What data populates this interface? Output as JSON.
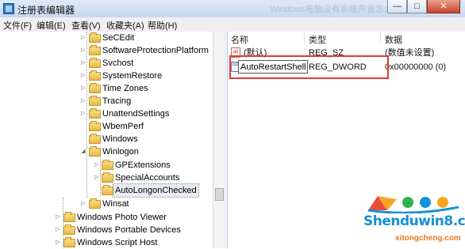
{
  "window": {
    "title": "注册表编辑器",
    "ghost_title": "Windows电脑没有系统声音怎么办",
    "min_glyph": "—",
    "max_glyph": "□",
    "close_glyph": "✕"
  },
  "menu": [
    "文件(F)",
    "编辑(E)",
    "查看(V)",
    "收藏夹(A)",
    "帮助(H)"
  ],
  "tree": [
    {
      "label": "SeCEdit",
      "arrow": "▷"
    },
    {
      "label": "SoftwareProtectionPlatform",
      "arrow": "▷"
    },
    {
      "label": "Svchost",
      "arrow": "▷"
    },
    {
      "label": "SystemRestore",
      "arrow": "▷"
    },
    {
      "label": "Time Zones",
      "arrow": "▷"
    },
    {
      "label": "Tracing",
      "arrow": "▷"
    },
    {
      "label": "UnattendSettings",
      "arrow": "▷"
    },
    {
      "label": "WbemPerf",
      "arrow": ""
    },
    {
      "label": "Windows",
      "arrow": ""
    },
    {
      "label": "Winlogon",
      "arrow": "◢"
    },
    {
      "label": "GPExtensions",
      "arrow": "▷"
    },
    {
      "label": "SpecialAccounts",
      "arrow": "▷"
    },
    {
      "label": "AutoLongonChecked",
      "arrow": ""
    },
    {
      "label": "Winsat",
      "arrow": "▷"
    },
    {
      "label": "Windows Photo Viewer",
      "arrow": "▷"
    },
    {
      "label": "Windows Portable Devices",
      "arrow": "▷"
    },
    {
      "label": "Windows Script Host",
      "arrow": "▷"
    }
  ],
  "list": {
    "headers": {
      "name": "名称",
      "type": "类型",
      "data": "数据"
    },
    "rows": [
      {
        "name": "(默认)",
        "type": "REG_SZ",
        "data": "(数值未设置)",
        "icon": "ab"
      },
      {
        "name": "AutoRestartShell",
        "type": "REG_DWORD",
        "data": "0x00000000 (0)",
        "icon": "011"
      }
    ]
  },
  "watermark": {
    "main": "Shenduwin8.com",
    "sub": "xitongcheng.com",
    "accent": "#1690d8"
  }
}
